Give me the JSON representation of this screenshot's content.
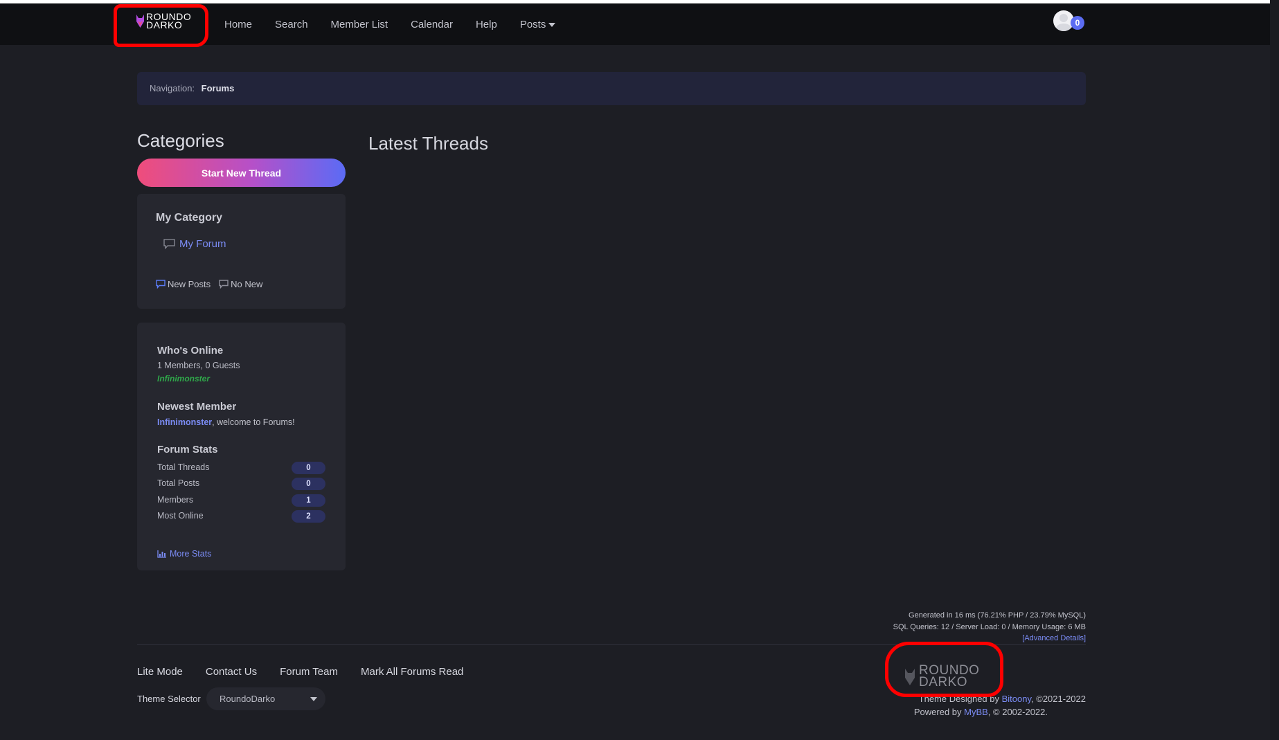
{
  "header": {
    "logo": {
      "line1": "ROUNDO",
      "line2": "DARKO"
    },
    "nav": [
      "Home",
      "Search",
      "Member List",
      "Calendar",
      "Help",
      "Posts"
    ],
    "notification_count": "0"
  },
  "breadcrumb": {
    "label": "Navigation:",
    "current": "Forums"
  },
  "sidebar": {
    "heading": "Categories",
    "start_thread_label": "Start New Thread",
    "category": {
      "title": "My Category",
      "forum": "My Forum",
      "legend_new": "New Posts",
      "legend_no_new": "No New"
    },
    "whos_online": {
      "title": "Who's Online",
      "summary": "1 Members, 0 Guests",
      "user": "Infinimonster"
    },
    "newest_member": {
      "title": "Newest Member",
      "name": "Infinimonster",
      "welcome": ", welcome to Forums!"
    },
    "forum_stats": {
      "title": "Forum Stats",
      "rows": [
        {
          "label": "Total Threads",
          "value": "0"
        },
        {
          "label": "Total Posts",
          "value": "0"
        },
        {
          "label": "Members",
          "value": "1"
        },
        {
          "label": "Most Online",
          "value": "2"
        }
      ],
      "more_label": "More Stats"
    }
  },
  "main": {
    "heading": "Latest Threads"
  },
  "debug": {
    "line1": "Generated in 16 ms (76.21% PHP / 23.79% MySQL)",
    "line2": "SQL Queries: 12 / Server Load: 0 / Memory Usage: 6 MB",
    "advanced": "[Advanced Details]"
  },
  "footer": {
    "links": [
      "Lite Mode",
      "Contact Us",
      "Forum Team",
      "Mark All Forums Read"
    ],
    "theme_label": "Theme Selector",
    "theme_value": "RoundoDarko",
    "logo": {
      "line1": "ROUNDO",
      "line2": "DARKO"
    },
    "designed_prefix": "Theme Designed by ",
    "designed_by": "Bitoony",
    "designed_suffix": ", ©2021-2022",
    "powered_prefix": "Powered by ",
    "powered_by": "MyBB",
    "powered_suffix": ", © 2002-2022."
  },
  "colors": {
    "accent": "#7b8cf5",
    "online_user": "#2fa84a",
    "annotation": "#ff0000"
  }
}
